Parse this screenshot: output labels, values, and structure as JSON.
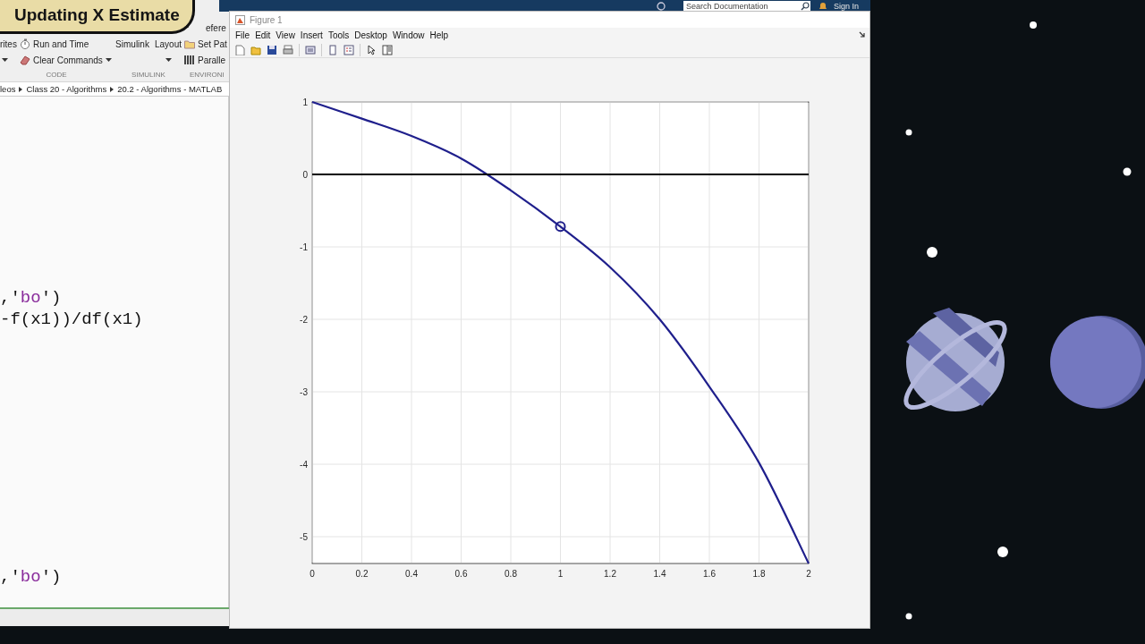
{
  "banner": {
    "title": "Updating X Estimate"
  },
  "topbar": {
    "search": {
      "placeholder": "Search Documentation"
    },
    "sign_in": "Sign In"
  },
  "matlab": {
    "toolstrip": {
      "favorites": "rites",
      "run_and_time": "Run and Time",
      "clear_commands": "Clear Commands",
      "simulink": "Simulink",
      "layout": "Layout",
      "reference": "efere",
      "set_path": "Set Pat",
      "parallel": "Paralle",
      "sections": [
        "CODE",
        "SIMULINK",
        "ENVIRONI"
      ]
    },
    "breadcrumb": [
      "leos",
      "Class 20 - Algorithms",
      "20.2 - Algorithms - MATLAB"
    ],
    "editor": {
      "blocks": [
        [
          [
            {
              "kind": "code",
              "text": ",'"
            },
            {
              "kind": "string",
              "text": "bo"
            },
            {
              "kind": "code",
              "text": "')"
            }
          ],
          [
            {
              "kind": "code",
              "text": "-f(x1))/df(x1)"
            }
          ]
        ],
        [
          [
            {
              "kind": "code",
              "text": ",'"
            },
            {
              "kind": "string",
              "text": "bo"
            },
            {
              "kind": "code",
              "text": "')"
            }
          ]
        ]
      ]
    }
  },
  "figure": {
    "title": "Figure 1",
    "menus": [
      "File",
      "Edit",
      "View",
      "Insert",
      "Tools",
      "Desktop",
      "Window",
      "Help"
    ],
    "chart_data": {
      "type": "line",
      "x": [
        0,
        0.2,
        0.4,
        0.6,
        0.8,
        1,
        1.2,
        1.4,
        1.6,
        1.8,
        2
      ],
      "series": [
        {
          "color": "#1f1f8c",
          "values": [
            1,
            0.77,
            0.53,
            0.22,
            -0.22,
            -0.72,
            -1.28,
            -2.0,
            -2.93,
            -3.98,
            -5.37
          ]
        },
        {
          "color": "#000000",
          "values": [
            0,
            0,
            0,
            0,
            0,
            0,
            0,
            0,
            0,
            0,
            0
          ]
        },
        {
          "color": "#1f1f8c",
          "marker": "o",
          "values": [
            null,
            null,
            null,
            null,
            null,
            -0.72,
            null,
            null,
            null,
            null,
            null
          ]
        }
      ],
      "grid": true,
      "xlim": [
        0,
        2
      ],
      "ylim": [
        -5.37,
        1
      ],
      "xticks": [
        0,
        0.2,
        0.4,
        0.6,
        0.8,
        1,
        1.2,
        1.4,
        1.6,
        1.8,
        2
      ],
      "yticks": [
        1,
        0,
        -1,
        -2,
        -3,
        -4,
        -5
      ]
    }
  }
}
